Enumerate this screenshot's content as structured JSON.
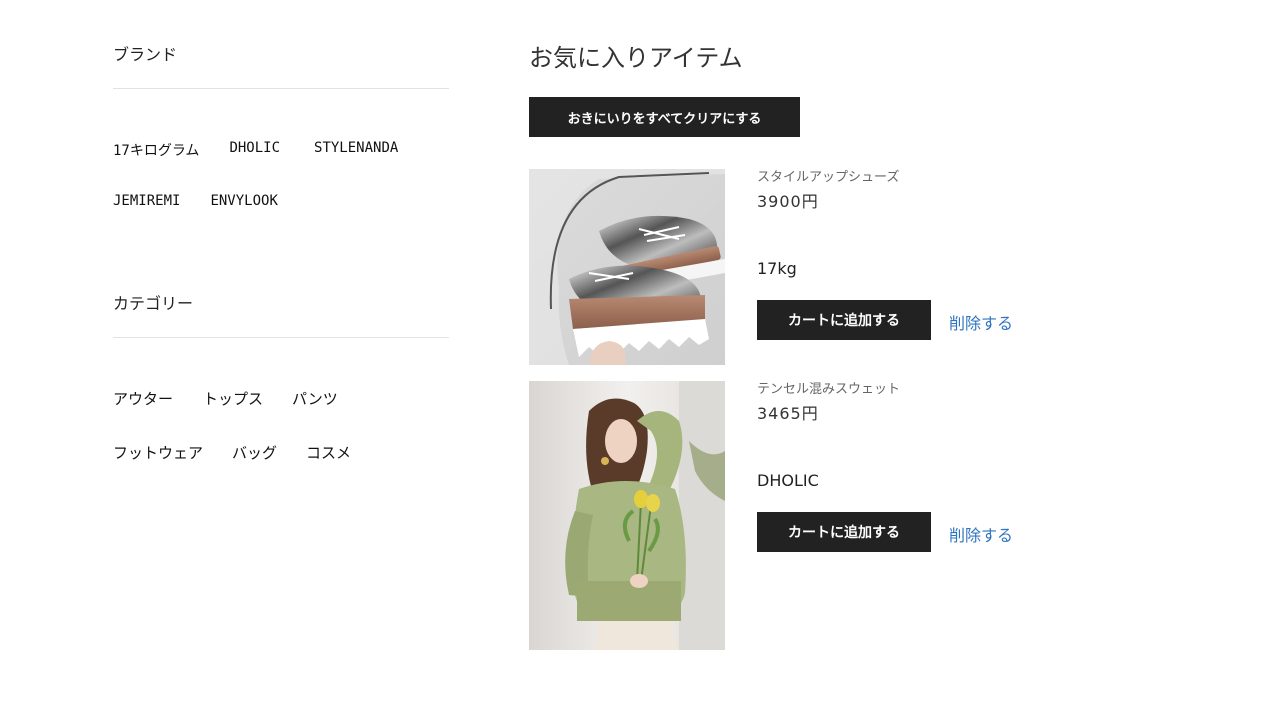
{
  "sidebar": {
    "brand_title": "ブランド",
    "brands": [
      "17キログラム",
      "DHOLIC",
      "STYLENANDA",
      "JEMIREMI",
      "ENVYLOOK"
    ],
    "category_title": "カテゴリー",
    "categories": [
      "アウター",
      "トップス",
      "パンツ",
      "フットウェア",
      "バッグ",
      "コスメ"
    ]
  },
  "main": {
    "title": "お気に入りアイテム",
    "clear_all_label": "おきにいりをすべてクリアにする",
    "items": [
      {
        "name": "スタイルアップシューズ",
        "price": "3900円",
        "brand": "17kg",
        "add_to_cart_label": "カートに追加する",
        "remove_label": "削除する"
      },
      {
        "name": "テンセル混みスウェット",
        "price": "3465円",
        "brand": "DHOLIC",
        "add_to_cart_label": "カートに追加する",
        "remove_label": "削除する"
      }
    ]
  },
  "colors": {
    "button_bg": "#222222",
    "link": "#2f74c0",
    "divider": "#e2e2e2"
  }
}
